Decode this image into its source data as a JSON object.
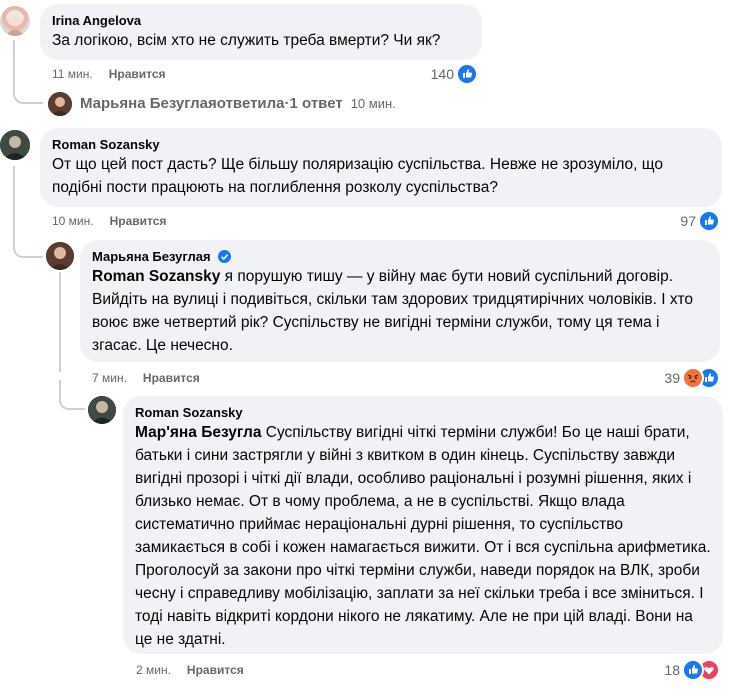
{
  "colors": {
    "bubble": "#f0f2f5",
    "meta_text": "#65676b",
    "like_blue": "#1877f2",
    "angry_orange": "#f0733d",
    "love_red": "#f33e58",
    "thread_line": "#ced0d4"
  },
  "comments": [
    {
      "author": "Irina Angelova",
      "text": "За логікою, всім хто не служить треба вмерти? Чи як?",
      "time": "11 мин.",
      "like_label": "Нравится",
      "reaction_count": "140",
      "reactions": [
        "like-icon"
      ]
    },
    {
      "author": "Roman Sozansky",
      "text": "От що цей пост дасть? Ще більшу поляризацію суспільства. Невже не зрозуміло, що подібні пости працюють на поглиблення розколу суспільства?",
      "time": "10 мин.",
      "like_label": "Нравится",
      "reaction_count": "97",
      "reactions": [
        "like-icon"
      ]
    },
    {
      "author": "Марьяна Безуглая",
      "verified": true,
      "mention": "Roman Sozansky",
      "text": " я порушую тишу — у війну має бути новий суспільний договір. Вийдіть на вулиці і подивіться, скільки там здорових тридцятирічних чоловіків. І хто воює вже четвертий рік? Суспільству не вигідні терміни служби, тому ця тема і згасає. Це нечесно.",
      "time": "7 мин.",
      "like_label": "Нравится",
      "reaction_count": "39",
      "reactions": [
        "angry-icon",
        "like-icon"
      ]
    },
    {
      "author": "Roman Sozansky",
      "mention": "Мар'яна Безугла",
      "text": " Суспільству вигідні чіткі терміни служби! Бо це наші брати, батьки і сини застрягли у війні з квитком в один кінець. Суспільству завжди вигідні прозорі і чіткі дії влади, особливо раціональні і розумні рішення, яких і близько немає. От в чому проблема, а не в суспільстві. Якщо влада систематично приймає нераціональні дурні рішення, то суспільство замикається в собі і кожен намагається вижити. От і вся суспільна арифметика. Проголосуй за закони про чіткі терміни служби, наведи порядок на ВЛК, зроби чесну і справедливу мобілізацію, заплати за неї скільки треба і все зміниться. І тоді навіть відкриті кордони нікого не лякатиму. Але не при цій владі. Вони на це не здатні.",
      "time": "2 мин.",
      "like_label": "Нравится",
      "reaction_count": "18",
      "reactions": [
        "like-icon",
        "love-icon"
      ]
    }
  ],
  "reply_summary": {
    "author": "Марьяна Безуглая",
    "action": " ответила",
    "separator": " · ",
    "count_text": "1 ответ",
    "time": "10 мин."
  }
}
